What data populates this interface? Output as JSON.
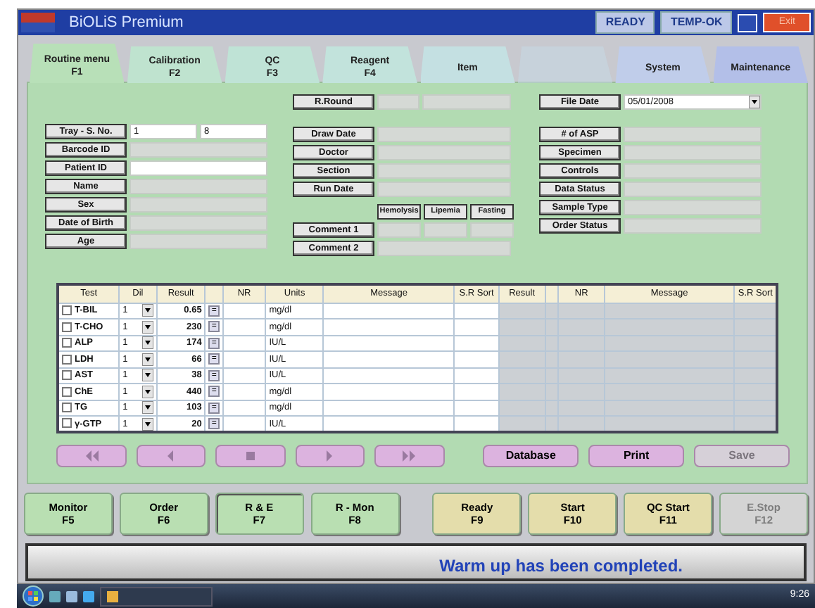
{
  "title_bar": {
    "title": "BiOLiS Premium",
    "indicators": [
      "READY",
      "TEMP-OK"
    ],
    "exit_button": "Exit"
  },
  "tabs": [
    {
      "label": "Routine menu",
      "key": "F1",
      "selected": true,
      "disabled": false,
      "color": "#b8e0b8"
    },
    {
      "label": "Calibration",
      "key": "F2",
      "selected": false,
      "disabled": false,
      "color": "#bfe3cf"
    },
    {
      "label": "QC",
      "key": "F3",
      "selected": false,
      "disabled": false,
      "color": "#bfe3d6"
    },
    {
      "label": "Reagent",
      "key": "F4",
      "selected": false,
      "disabled": false,
      "color": "#c2e3dc"
    },
    {
      "label": "Item",
      "selected": false,
      "disabled": false,
      "color": "#c4e0e2"
    },
    {
      "selected": false,
      "disabled": true,
      "color": "#c6d8e6"
    },
    {
      "label": "System",
      "selected": false,
      "disabled": false,
      "color": "#c0cdea"
    },
    {
      "label": "Maintenance",
      "selected": false,
      "disabled": false,
      "color": "#b3bfe8"
    }
  ],
  "left_fields": [
    {
      "label": "Tray - S. No.",
      "values": [
        "1",
        "8"
      ],
      "editable": true
    },
    {
      "label": "Barcode ID",
      "editable": false
    },
    {
      "label": "Patient ID",
      "editable": true
    },
    {
      "label": "Name",
      "editable": false
    },
    {
      "label": "Sex",
      "editable": false
    },
    {
      "label": "Date of Birth",
      "editable": false
    },
    {
      "label": "Age",
      "editable": false
    }
  ],
  "middle_fields": [
    {
      "label": "R.Round",
      "split": true
    },
    {
      "label": "Draw Date"
    },
    {
      "label": "Doctor"
    },
    {
      "label": "Section"
    },
    {
      "label": "Run Date"
    }
  ],
  "comment_columns": [
    "Hemolysis",
    "Lipemia",
    "Fasting"
  ],
  "comments": [
    {
      "label": "Comment 1",
      "split": true
    },
    {
      "label": "Comment 2"
    }
  ],
  "right_fields": [
    {
      "label": "File Date",
      "value": "05/01/2008",
      "kind": "dropdown"
    },
    {
      "label": "# of ASP",
      "kind": "text"
    },
    {
      "label": "Specimen",
      "kind": "text"
    },
    {
      "label": "Controls",
      "kind": "text"
    },
    {
      "label": "Data Status",
      "kind": "text"
    },
    {
      "label": "Sample Type",
      "kind": "text"
    },
    {
      "label": "Order Status",
      "kind": "text"
    }
  ],
  "table": {
    "columns": [
      "Test",
      "Dil",
      "Result",
      "NR",
      "Units",
      "Message",
      "S.R Sort",
      "Result",
      "NR",
      "Message",
      "S.R Sort"
    ],
    "rows": [
      {
        "checked": false,
        "test": "T-BIL",
        "dil": "1",
        "result": "0.65",
        "flag": "=",
        "units": "mg/dl"
      },
      {
        "checked": false,
        "test": "T-CHO",
        "dil": "1",
        "result": "230",
        "flag": "=",
        "units": "mg/dl"
      },
      {
        "checked": false,
        "test": "ALP",
        "dil": "1",
        "result": "174",
        "flag": "=",
        "units": "IU/L"
      },
      {
        "checked": false,
        "test": "LDH",
        "dil": "1",
        "result": "66",
        "flag": "=",
        "units": "IU/L"
      },
      {
        "checked": false,
        "test": "AST",
        "dil": "1",
        "result": "38",
        "flag": "=",
        "units": "IU/L"
      },
      {
        "checked": false,
        "test": "ChE",
        "dil": "1",
        "result": "440",
        "flag": "=",
        "units": "mg/dl"
      },
      {
        "checked": false,
        "test": "TG",
        "dil": "1",
        "result": "103",
        "flag": "=",
        "units": "mg/dl"
      },
      {
        "checked": false,
        "test": "γ-GTP",
        "dil": "1",
        "result": "20",
        "flag": "=",
        "units": "IU/L"
      }
    ]
  },
  "nav_buttons": [
    {
      "kind": "first"
    },
    {
      "kind": "previous"
    },
    {
      "kind": "stop"
    },
    {
      "kind": "next"
    },
    {
      "kind": "last"
    }
  ],
  "action_buttons": [
    {
      "label": "Database",
      "disabled": false
    },
    {
      "label": "Print",
      "disabled": false
    },
    {
      "label": "Save",
      "disabled": true
    }
  ],
  "function_keys": [
    {
      "label": "Monitor",
      "key": "F5",
      "color": "#b9dfb2",
      "selected": false,
      "disabled": false
    },
    {
      "label": "Order",
      "key": "F6",
      "color": "#b9dfb2",
      "selected": false,
      "disabled": false
    },
    {
      "label": "R & E",
      "key": "F7",
      "color": "#b9dfb2",
      "selected": true,
      "disabled": false
    },
    {
      "label": "R - Mon",
      "key": "F8",
      "color": "#b9dfb2",
      "selected": false,
      "disabled": false
    },
    {
      "label": "Ready",
      "key": "F9",
      "color": "#e4ddab",
      "selected": false,
      "disabled": false
    },
    {
      "label": "Start",
      "key": "F10",
      "color": "#e4ddab",
      "selected": false,
      "disabled": false
    },
    {
      "label": "QC Start",
      "key": "F11",
      "color": "#e4ddab",
      "selected": false,
      "disabled": false
    },
    {
      "label": "E.Stop",
      "key": "F12",
      "color": "#d4d4d4",
      "selected": false,
      "disabled": true
    }
  ],
  "status_message": "Warm up has been completed.",
  "taskbar": {
    "clock": "9:26"
  }
}
